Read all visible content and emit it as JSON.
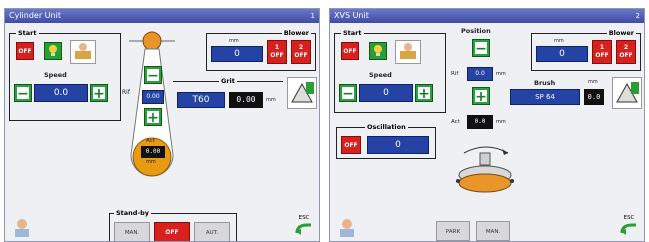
{
  "left": {
    "title": "Cylinder Unit",
    "number": "1",
    "start_label": "Start",
    "off_label": "OFF",
    "speed_label": "Speed",
    "speed_value": "0.0",
    "minus_label": "−",
    "plus_label": "+",
    "rif_label": "Rif",
    "rif_value": "0.00",
    "act_label": "Act",
    "act_value": "0.00",
    "act_unit": "mm",
    "blower_label": "Blower",
    "blower_unit": "mm",
    "blower_value": "0",
    "blower_btn1_num": "1",
    "blower_btn1_text": "OFF",
    "blower_btn2_num": "2",
    "blower_btn2_text": "OFF",
    "grit_label": "Grit",
    "grit_value": "T60",
    "grit_number": "0.00",
    "grit_unit": "mm",
    "standby_label": "Stand-by",
    "man_label": "MAN.",
    "off2_label": "OFF",
    "aut_label": "AUT.",
    "esc_label": "ESC"
  },
  "right": {
    "title": "XVS Unit",
    "number": "2",
    "start_label": "Start",
    "off_label": "OFF",
    "speed_label": "Speed",
    "speed_value": "0",
    "minus_label": "−",
    "plus_label": "+",
    "position_label": "Position",
    "rif_label": "Rif",
    "rif_value": "0.0",
    "rif_unit": "mm",
    "act_label": "Act",
    "act_value": "0.0",
    "act_unit": "mm",
    "blower_label": "Blower",
    "blower_unit": "mm",
    "blower_value": "0",
    "blower_btn1_num": "1",
    "blower_btn1_text": "OFF",
    "blower_btn2_num": "2",
    "blower_btn2_text": "OFF",
    "brush_label": "Brush",
    "brush_value": "SP 64",
    "brush_number": "0.0",
    "brush_unit": "mm",
    "oscillation_label": "Oscillation",
    "oscillation_off": "OFF",
    "oscillation_value": "0",
    "park_label": "PARK",
    "man_label": "MAN.",
    "esc_label": "ESC"
  },
  "colors": {
    "titlebar": "#4653b0",
    "red": "#d8201c",
    "green": "#2a9e36",
    "blue_field": "#2543a5",
    "orange_act": "#e89a12"
  }
}
